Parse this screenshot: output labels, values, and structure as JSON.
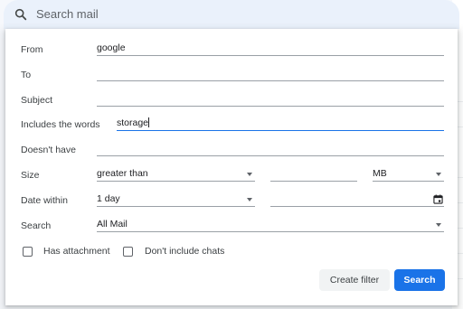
{
  "search": {
    "placeholder": "Search mail"
  },
  "form": {
    "from": {
      "label": "From",
      "value": "google"
    },
    "to": {
      "label": "To",
      "value": ""
    },
    "subject": {
      "label": "Subject",
      "value": ""
    },
    "includes": {
      "label": "Includes the words",
      "value": "storage"
    },
    "doesnt_have": {
      "label": "Doesn't have",
      "value": ""
    },
    "size": {
      "label": "Size",
      "operator": "greater than",
      "value": "",
      "unit": "MB"
    },
    "date_within": {
      "label": "Date within",
      "value": "1 day",
      "date": ""
    },
    "search_in": {
      "label": "Search",
      "value": "All Mail"
    },
    "has_attachment": {
      "label": "Has attachment",
      "checked": false
    },
    "dont_include_chats": {
      "label": "Don't include chats",
      "checked": false
    }
  },
  "buttons": {
    "create_filter": "Create filter",
    "search": "Search"
  },
  "colors": {
    "accent": "#1a73e8",
    "search_bar_bg": "#eaf1fb",
    "secondary_button_bg": "#f1f3f4"
  },
  "icons": [
    "search-icon",
    "dropdown-arrow-icon",
    "calendar-icon"
  ]
}
